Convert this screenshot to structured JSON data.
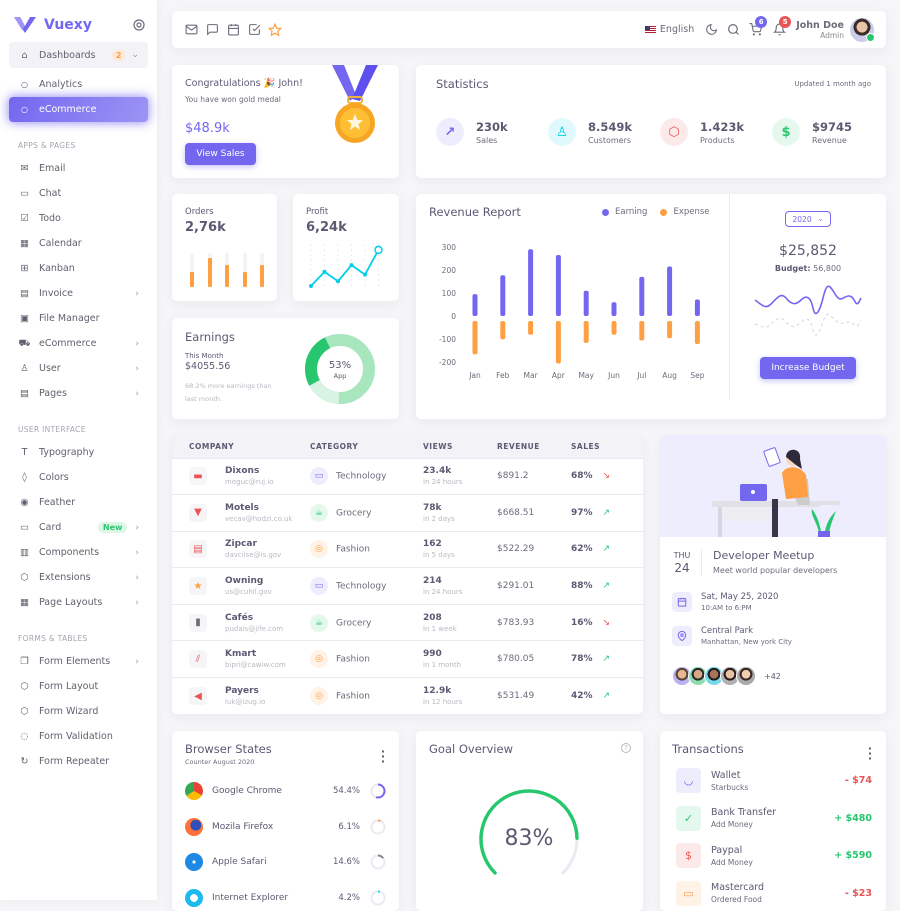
{
  "app": {
    "name": "Vuexy"
  },
  "sidebar": {
    "dashboards": {
      "label": "Dashboards",
      "badge": "2"
    },
    "dashboard_children": [
      {
        "label": "Analytics",
        "active": false
      },
      {
        "label": "eCommerce",
        "active": true
      }
    ],
    "sections": [
      {
        "title": "APPS & PAGES",
        "items": [
          {
            "label": "Email",
            "icon": "mail-icon"
          },
          {
            "label": "Chat",
            "icon": "message-square-icon"
          },
          {
            "label": "Todo",
            "icon": "check-square-icon"
          },
          {
            "label": "Calendar",
            "icon": "calendar-icon"
          },
          {
            "label": "Kanban",
            "icon": "grid-icon"
          },
          {
            "label": "Invoice",
            "icon": "file-text-icon",
            "chevron": true
          },
          {
            "label": "File Manager",
            "icon": "save-icon"
          },
          {
            "label": "eCommerce",
            "icon": "shopping-cart-icon",
            "chevron": true
          },
          {
            "label": "User",
            "icon": "user-icon",
            "chevron": true
          },
          {
            "label": "Pages",
            "icon": "file-icon",
            "chevron": true
          }
        ]
      },
      {
        "title": "USER INTERFACE",
        "items": [
          {
            "label": "Typography",
            "icon": "type-icon"
          },
          {
            "label": "Colors",
            "icon": "droplet-icon"
          },
          {
            "label": "Feather",
            "icon": "eye-icon"
          },
          {
            "label": "Card",
            "icon": "credit-card-icon",
            "chevron": true,
            "badge": "New"
          },
          {
            "label": "Components",
            "icon": "briefcase-icon",
            "chevron": true
          },
          {
            "label": "Extensions",
            "icon": "package-icon",
            "chevron": true
          },
          {
            "label": "Page Layouts",
            "icon": "layout-icon",
            "chevron": true
          }
        ]
      },
      {
        "title": "FORMS & TABLES",
        "items": [
          {
            "label": "Form Elements",
            "icon": "copy-icon",
            "chevron": true
          },
          {
            "label": "Form Layout",
            "icon": "box-icon"
          },
          {
            "label": "Form Wizard",
            "icon": "package-icon"
          },
          {
            "label": "Form Validation",
            "icon": "check-circle-icon"
          },
          {
            "label": "Form Repeater",
            "icon": "rotate-cw-icon"
          }
        ]
      }
    ]
  },
  "navbar": {
    "language": "English",
    "cart_count": "6",
    "notification_count": "5",
    "user_name": "John Doe",
    "user_role": "Admin"
  },
  "congrats": {
    "title": "Congratulations 🎉 John!",
    "subtitle": "You have won gold medal",
    "amount": "$48.9k",
    "button": "View Sales"
  },
  "statistics": {
    "title": "Statistics",
    "updated": "Updated 1 month ago",
    "items": [
      {
        "value": "230k",
        "label": "Sales",
        "color": "#7367f0",
        "bg": "#eeedfd"
      },
      {
        "value": "8.549k",
        "label": "Customers",
        "color": "#00cfe8",
        "bg": "#e0f9fc"
      },
      {
        "value": "1.423k",
        "label": "Products",
        "color": "#ea5455",
        "bg": "#fceaea"
      },
      {
        "value": "$9745",
        "label": "Revenue",
        "color": "#28c76f",
        "bg": "#e5f8ed"
      }
    ]
  },
  "orders": {
    "title": "Orders",
    "value": "2,76k",
    "bars": [
      0.45,
      0.85,
      0.65,
      0.45,
      0.65
    ]
  },
  "profit": {
    "title": "Profit",
    "value": "6,24k",
    "points": [
      0,
      15,
      5,
      22,
      12,
      38
    ]
  },
  "earnings": {
    "title": "Earnings",
    "period": "This Month",
    "amount": "$4055.56",
    "note": "68.2% more earnings than last month.",
    "donut_value": "53%",
    "donut_label": "App"
  },
  "revenue_report": {
    "title": "Revenue Report",
    "year": "2020",
    "total": "$25,852",
    "budget_label": "Budget:",
    "budget_value": "56,800",
    "button": "Increase Budget"
  },
  "chart_data": {
    "type": "bar",
    "title": "Revenue Report",
    "categories": [
      "Jan",
      "Feb",
      "Mar",
      "Apr",
      "May",
      "Jun",
      "Jul",
      "Aug",
      "Sep"
    ],
    "series": [
      {
        "name": "Earning",
        "color": "#7367f0",
        "values": [
          95,
          177,
          290,
          265,
          110,
          60,
          170,
          215,
          72
        ]
      },
      {
        "name": "Expense",
        "color": "#ff9f43",
        "values": [
          -145,
          -80,
          -60,
          -185,
          -95,
          -60,
          -85,
          -75,
          -100
        ]
      }
    ],
    "yticks": [
      300,
      200,
      100,
      0,
      -100,
      -200
    ],
    "ylim": [
      -200,
      300
    ],
    "legend": "top-right"
  },
  "table": {
    "headers": [
      "COMPANY",
      "CATEGORY",
      "VIEWS",
      "REVENUE",
      "SALES"
    ],
    "rows": [
      {
        "company": "Dixons",
        "email": "meguc@ruj.io",
        "category": "Technology",
        "views": "23.4k",
        "time": "in 24 hours",
        "revenue": "$891.2",
        "sales": "68%",
        "trend": "down"
      },
      {
        "company": "Motels",
        "email": "vecav@hodzi.co.uk",
        "category": "Grocery",
        "views": "78k",
        "time": "in 2 days",
        "revenue": "$668.51",
        "sales": "97%",
        "trend": "up"
      },
      {
        "company": "Zipcar",
        "email": "davcilse@is.gov",
        "category": "Fashion",
        "views": "162",
        "time": "in 5 days",
        "revenue": "$522.29",
        "sales": "62%",
        "trend": "up"
      },
      {
        "company": "Owning",
        "email": "us@cuhil.gov",
        "category": "Technology",
        "views": "214",
        "time": "in 24 hours",
        "revenue": "$291.01",
        "sales": "88%",
        "trend": "up"
      },
      {
        "company": "Cafés",
        "email": "pudais@jife.com",
        "category": "Grocery",
        "views": "208",
        "time": "in 1 week",
        "revenue": "$783.93",
        "sales": "16%",
        "trend": "down"
      },
      {
        "company": "Kmart",
        "email": "bipri@cawiw.com",
        "category": "Fashion",
        "views": "990",
        "time": "in 1 month",
        "revenue": "$780.05",
        "sales": "78%",
        "trend": "up"
      },
      {
        "company": "Payers",
        "email": "luk@izug.io",
        "category": "Fashion",
        "views": "12.9k",
        "time": "in 12 hours",
        "revenue": "$531.49",
        "sales": "42%",
        "trend": "up"
      }
    ]
  },
  "meetup": {
    "day": "THU",
    "date": "24",
    "title": "Developer Meetup",
    "subtitle": "Meet world popular developers",
    "when": "Sat, May 25, 2020",
    "time": "10:AM to 6:PM",
    "where": "Central Park",
    "address": "Manhattan, New york City",
    "more": "+42"
  },
  "browser_states": {
    "title": "Browser States",
    "subtitle": "Counter August 2020",
    "items": [
      {
        "name": "Google Chrome",
        "value": "54.4%",
        "fraction": 0.544,
        "color": "#7367f0"
      },
      {
        "name": "Mozila Firefox",
        "value": "6.1%",
        "fraction": 0.061,
        "color": "#ff9f43"
      },
      {
        "name": "Apple Safari",
        "value": "14.6%",
        "fraction": 0.146,
        "color": "#82868b"
      },
      {
        "name": "Internet Explorer",
        "value": "4.2%",
        "fraction": 0.042,
        "color": "#00cfe8"
      }
    ]
  },
  "goal": {
    "title": "Goal Overview",
    "value": "83%",
    "fraction": 0.83
  },
  "transactions": {
    "title": "Transactions",
    "items": [
      {
        "name": "Wallet",
        "sub": "Starbucks",
        "amount": "- $74",
        "positive": false
      },
      {
        "name": "Bank Transfer",
        "sub": "Add Money",
        "amount": "+ $480",
        "positive": true
      },
      {
        "name": "Paypal",
        "sub": "Add Money",
        "amount": "+ $590",
        "positive": true
      },
      {
        "name": "Mastercard",
        "sub": "Ordered Food",
        "amount": "- $23",
        "positive": false
      }
    ]
  }
}
